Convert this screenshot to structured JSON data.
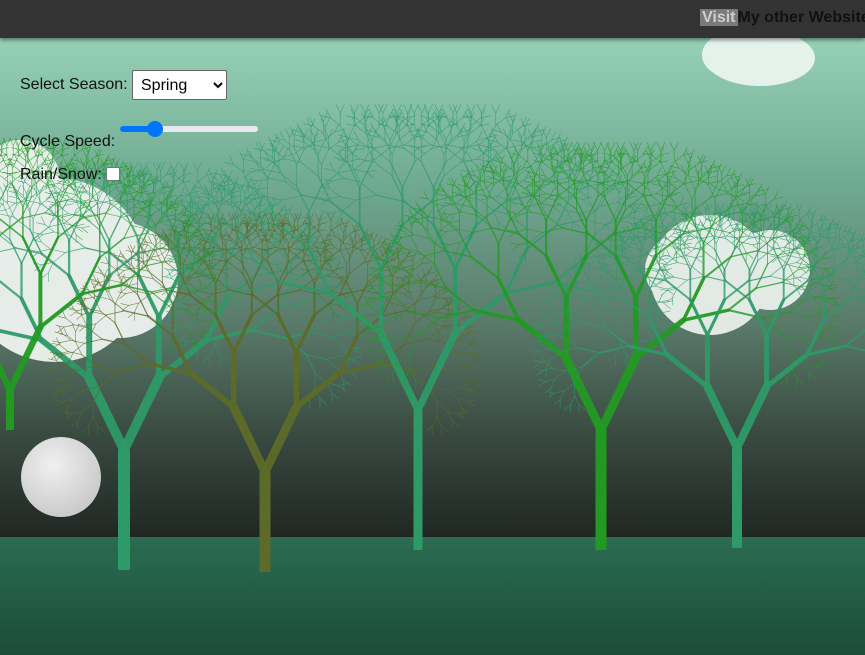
{
  "header": {
    "visit_label": "Visit",
    "link_text": "My other Website"
  },
  "controls": {
    "season_label": "Select Season:",
    "season_selected": "Spring",
    "speed_label": "Cycle Speed:",
    "speed_value_fraction": 0.25,
    "rain_label": "Rain/Snow:",
    "rain_checked": false
  },
  "colors": {
    "sky_top": "#9fd8bd",
    "sky_bottom": "#222a25",
    "ground_top": "#2a6b50",
    "ground_bottom": "#1a4a38",
    "tree_green": "#2e9a68",
    "tree_bright": "#229a22",
    "tree_olive": "#5d6b28",
    "accent_blue": "#0075ff"
  }
}
